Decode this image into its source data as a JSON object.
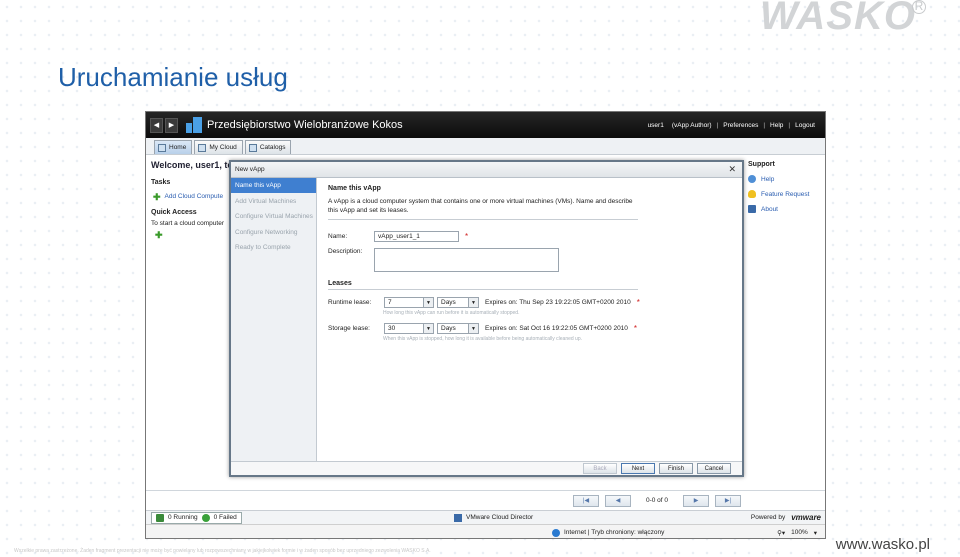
{
  "slide": {
    "brand": "WASKO",
    "brand_reg": "R",
    "title": "Uruchamianie usług",
    "footer_left": "Wszelkie prawa zastrzeżone. Żaden fragment prezentacji nie może być powielany lub rozpowszechniany w jakiejkolwiek formie i w żaden sposób bez uprzedniego zezwolenia WASKO S.A.",
    "footer_right": "www.wasko.pl"
  },
  "app": {
    "org_name": "Przedsiębiorstwo Wielobranżowe Kokos",
    "nav": {
      "user": "user1",
      "role": "(vApp Author)",
      "sep": "|",
      "preferences": "Preferences",
      "help": "Help",
      "logout": "Logout"
    },
    "tabs": [
      {
        "label": "Home"
      },
      {
        "label": "My Cloud"
      },
      {
        "label": "Catalogs"
      }
    ],
    "welcome": "Welcome, user1, to",
    "tasks_header": "Tasks",
    "task_item": "Add Cloud Compute",
    "quick_access_header": "Quick Access",
    "quick_access_text": "To start a cloud computer",
    "support": {
      "header": "Support",
      "items": [
        "Help",
        "Feature Request",
        "About"
      ]
    },
    "pager": {
      "count": "0-0 of 0"
    },
    "status": {
      "running": "0 Running",
      "failed": "0 Failed",
      "product": "VMware Cloud Director",
      "powered_by": "Powered by",
      "vm_logo": "vmware"
    },
    "browser": {
      "zone": "Internet | Tryb chroniony: włączony",
      "zoom": "100%"
    }
  },
  "dialog": {
    "title": "New vApp",
    "close": "✕",
    "steps": [
      {
        "label": "Name this vApp",
        "active": true
      },
      {
        "label": "Add Virtual Machines",
        "active": false
      },
      {
        "label": "Configure Virtual Machines",
        "active": false
      },
      {
        "label": "Configure Networking",
        "active": false
      },
      {
        "label": "Ready to Complete",
        "active": false
      }
    ],
    "section_name": "Name this vApp",
    "description": "A vApp is a cloud computer system that contains one or more virtual machines (VMs). Name and describe this vApp and set its leases.",
    "name_label": "Name:",
    "name_value": "vApp_user1_1",
    "desc_label": "Description:",
    "leases_header": "Leases",
    "runtime": {
      "label": "Runtime lease:",
      "value": "7",
      "unit": "Days",
      "expires": "Expires on: Thu Sep 23 19:22:05 GMT+0200 2010",
      "hint": "How long this vApp can run before it is automatically stopped."
    },
    "storage": {
      "label": "Storage lease:",
      "value": "30",
      "unit": "Days",
      "expires": "Expires on: Sat Oct 16 19:22:05 GMT+0200 2010",
      "hint": "When this vApp is stopped, how long it is available before being automatically cleaned up."
    },
    "required_mark": "*",
    "buttons": {
      "back": "Back",
      "next": "Next",
      "finish": "Finish",
      "cancel": "Cancel"
    }
  }
}
